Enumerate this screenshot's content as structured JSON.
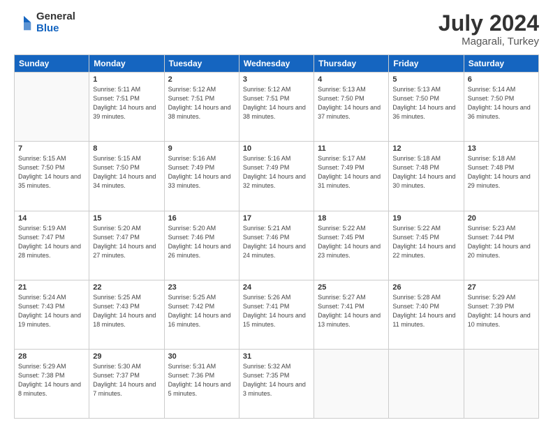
{
  "header": {
    "logo_general": "General",
    "logo_blue": "Blue",
    "month_year": "July 2024",
    "location": "Magarali, Turkey"
  },
  "weekdays": [
    "Sunday",
    "Monday",
    "Tuesday",
    "Wednesday",
    "Thursday",
    "Friday",
    "Saturday"
  ],
  "weeks": [
    [
      {
        "day": "",
        "info": ""
      },
      {
        "day": "1",
        "sunrise": "5:11 AM",
        "sunset": "7:51 PM",
        "daylight": "14 hours and 39 minutes."
      },
      {
        "day": "2",
        "sunrise": "5:12 AM",
        "sunset": "7:51 PM",
        "daylight": "14 hours and 38 minutes."
      },
      {
        "day": "3",
        "sunrise": "5:12 AM",
        "sunset": "7:51 PM",
        "daylight": "14 hours and 38 minutes."
      },
      {
        "day": "4",
        "sunrise": "5:13 AM",
        "sunset": "7:50 PM",
        "daylight": "14 hours and 37 minutes."
      },
      {
        "day": "5",
        "sunrise": "5:13 AM",
        "sunset": "7:50 PM",
        "daylight": "14 hours and 36 minutes."
      },
      {
        "day": "6",
        "sunrise": "5:14 AM",
        "sunset": "7:50 PM",
        "daylight": "14 hours and 36 minutes."
      }
    ],
    [
      {
        "day": "7",
        "sunrise": "5:15 AM",
        "sunset": "7:50 PM",
        "daylight": "14 hours and 35 minutes."
      },
      {
        "day": "8",
        "sunrise": "5:15 AM",
        "sunset": "7:50 PM",
        "daylight": "14 hours and 34 minutes."
      },
      {
        "day": "9",
        "sunrise": "5:16 AM",
        "sunset": "7:49 PM",
        "daylight": "14 hours and 33 minutes."
      },
      {
        "day": "10",
        "sunrise": "5:16 AM",
        "sunset": "7:49 PM",
        "daylight": "14 hours and 32 minutes."
      },
      {
        "day": "11",
        "sunrise": "5:17 AM",
        "sunset": "7:49 PM",
        "daylight": "14 hours and 31 minutes."
      },
      {
        "day": "12",
        "sunrise": "5:18 AM",
        "sunset": "7:48 PM",
        "daylight": "14 hours and 30 minutes."
      },
      {
        "day": "13",
        "sunrise": "5:18 AM",
        "sunset": "7:48 PM",
        "daylight": "14 hours and 29 minutes."
      }
    ],
    [
      {
        "day": "14",
        "sunrise": "5:19 AM",
        "sunset": "7:47 PM",
        "daylight": "14 hours and 28 minutes."
      },
      {
        "day": "15",
        "sunrise": "5:20 AM",
        "sunset": "7:47 PM",
        "daylight": "14 hours and 27 minutes."
      },
      {
        "day": "16",
        "sunrise": "5:20 AM",
        "sunset": "7:46 PM",
        "daylight": "14 hours and 26 minutes."
      },
      {
        "day": "17",
        "sunrise": "5:21 AM",
        "sunset": "7:46 PM",
        "daylight": "14 hours and 24 minutes."
      },
      {
        "day": "18",
        "sunrise": "5:22 AM",
        "sunset": "7:45 PM",
        "daylight": "14 hours and 23 minutes."
      },
      {
        "day": "19",
        "sunrise": "5:22 AM",
        "sunset": "7:45 PM",
        "daylight": "14 hours and 22 minutes."
      },
      {
        "day": "20",
        "sunrise": "5:23 AM",
        "sunset": "7:44 PM",
        "daylight": "14 hours and 20 minutes."
      }
    ],
    [
      {
        "day": "21",
        "sunrise": "5:24 AM",
        "sunset": "7:43 PM",
        "daylight": "14 hours and 19 minutes."
      },
      {
        "day": "22",
        "sunrise": "5:25 AM",
        "sunset": "7:43 PM",
        "daylight": "14 hours and 18 minutes."
      },
      {
        "day": "23",
        "sunrise": "5:25 AM",
        "sunset": "7:42 PM",
        "daylight": "14 hours and 16 minutes."
      },
      {
        "day": "24",
        "sunrise": "5:26 AM",
        "sunset": "7:41 PM",
        "daylight": "14 hours and 15 minutes."
      },
      {
        "day": "25",
        "sunrise": "5:27 AM",
        "sunset": "7:41 PM",
        "daylight": "14 hours and 13 minutes."
      },
      {
        "day": "26",
        "sunrise": "5:28 AM",
        "sunset": "7:40 PM",
        "daylight": "14 hours and 11 minutes."
      },
      {
        "day": "27",
        "sunrise": "5:29 AM",
        "sunset": "7:39 PM",
        "daylight": "14 hours and 10 minutes."
      }
    ],
    [
      {
        "day": "28",
        "sunrise": "5:29 AM",
        "sunset": "7:38 PM",
        "daylight": "14 hours and 8 minutes."
      },
      {
        "day": "29",
        "sunrise": "5:30 AM",
        "sunset": "7:37 PM",
        "daylight": "14 hours and 7 minutes."
      },
      {
        "day": "30",
        "sunrise": "5:31 AM",
        "sunset": "7:36 PM",
        "daylight": "14 hours and 5 minutes."
      },
      {
        "day": "31",
        "sunrise": "5:32 AM",
        "sunset": "7:35 PM",
        "daylight": "14 hours and 3 minutes."
      },
      {
        "day": "",
        "info": ""
      },
      {
        "day": "",
        "info": ""
      },
      {
        "day": "",
        "info": ""
      }
    ]
  ]
}
